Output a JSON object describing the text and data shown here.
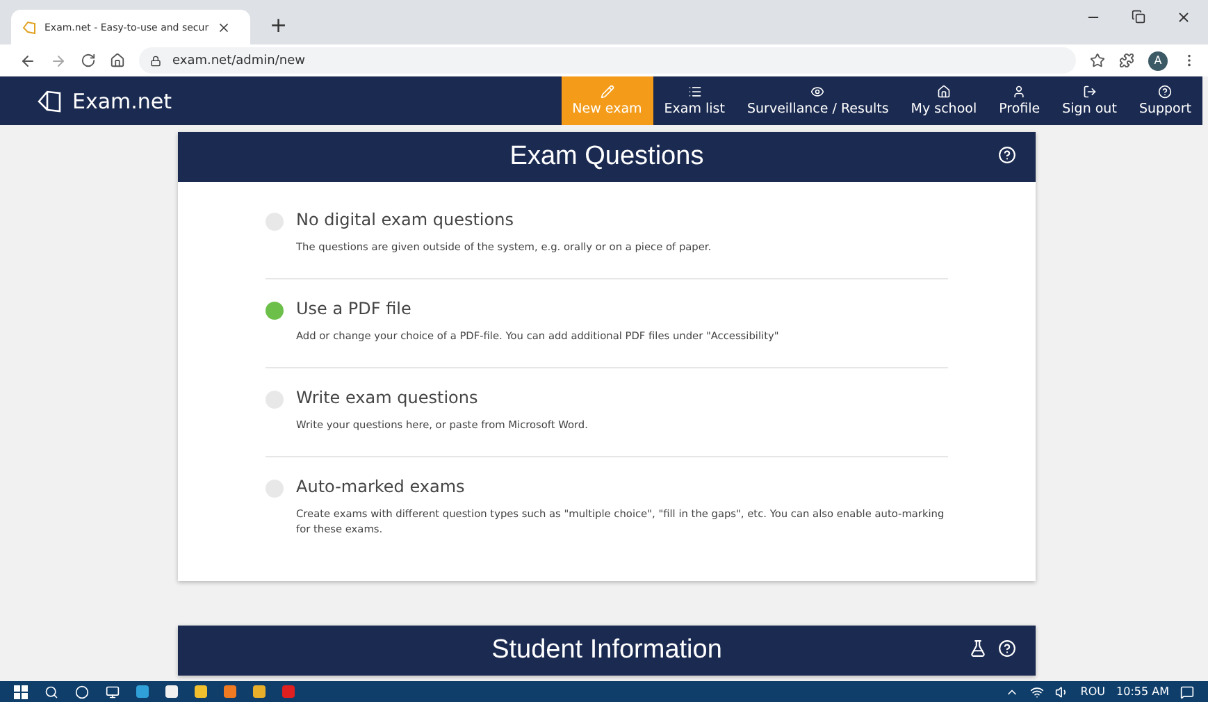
{
  "browser": {
    "tab_title": "Exam.net - Easy-to-use and secur",
    "new_tab": "+",
    "url": "exam.net/admin/new",
    "profile_initial": "A"
  },
  "nav": {
    "brand": "Exam.net",
    "items": [
      {
        "label": "New exam",
        "selected": true
      },
      {
        "label": "Exam list",
        "selected": false
      },
      {
        "label": "Surveillance / Results",
        "selected": false
      },
      {
        "label": "My school",
        "selected": false
      },
      {
        "label": "Profile",
        "selected": false
      },
      {
        "label": "Sign out",
        "selected": false
      },
      {
        "label": "Support",
        "selected": false
      }
    ]
  },
  "exam_questions": {
    "title": "Exam Questions",
    "options": [
      {
        "title": "No digital exam questions",
        "description": "The questions are given outside of the system, e.g. orally or on a piece of paper.",
        "selected": false
      },
      {
        "title": "Use a PDF file",
        "description": "Add or change your choice of a PDF-file. You can add additional PDF files under \"Accessibility\"",
        "selected": true
      },
      {
        "title": "Write exam questions",
        "description": "Write your questions here, or paste from Microsoft Word.",
        "selected": false
      },
      {
        "title": "Auto-marked exams",
        "description": "Create exams with different question types such as \"multiple choice\", \"fill in the gaps\", etc. You can also enable auto-marking for these exams.",
        "selected": false
      }
    ]
  },
  "student_information": {
    "title": "Student Information"
  },
  "taskbar": {
    "language": "ROU",
    "time": "10:55 AM"
  }
}
